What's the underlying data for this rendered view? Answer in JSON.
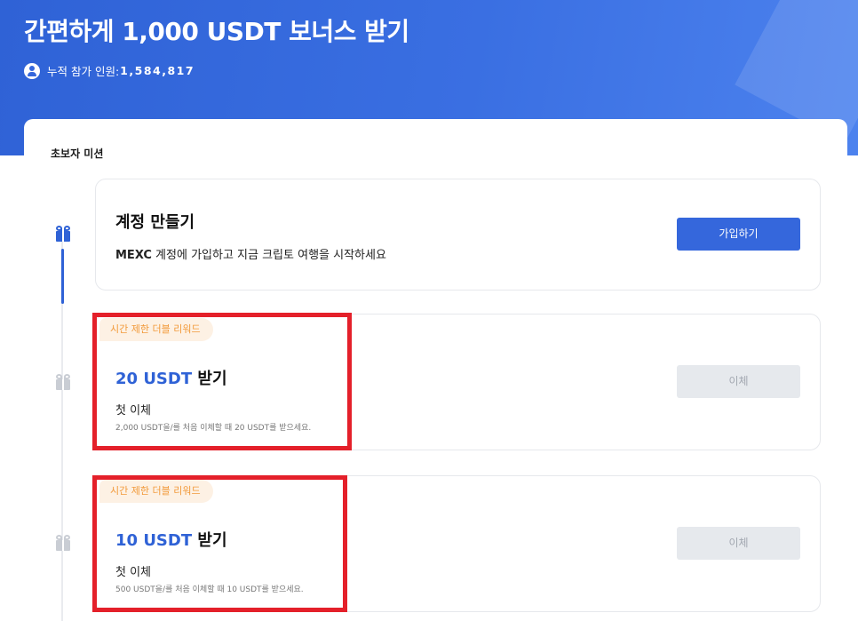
{
  "hero": {
    "title": "간편하게 1,000 USDT 보너스 받기",
    "participants_label": "누적 참가 인원:",
    "participants_value": "1,584,817"
  },
  "section": {
    "title": "초보자 미션"
  },
  "missions": [
    {
      "title": "계정 만들기",
      "desc_brand": "MEXC",
      "desc": " 계정에 가입하고 지금 크립토 여행을 시작하세요",
      "button": "가입하기",
      "state": "active"
    },
    {
      "tag": "시간 제한 더블 리워드",
      "amount": "20 USDT",
      "title_suffix": " 받기",
      "desc": "첫 이체",
      "detail": "2,000 USDT을/를 처음 이체할 때 20 USDT를 받으세요.",
      "button": "이체",
      "state": "disabled"
    },
    {
      "tag": "시간 제한 더블 리워드",
      "amount": "10 USDT",
      "title_suffix": " 받기",
      "desc": "첫 이체",
      "detail": "500 USDT을/를 처음 이체할 때 10 USDT를 받으세요.",
      "button": "이체",
      "state": "disabled"
    }
  ],
  "colors": {
    "accent": "#2f62d6",
    "tag_text": "#f29a3a",
    "tag_bg": "#fdf1e4",
    "highlight": "#e4202a",
    "disabled_bg": "#e6e9ed"
  },
  "icons": {
    "participants": "user-circle-icon",
    "mission": "gift-icon"
  }
}
